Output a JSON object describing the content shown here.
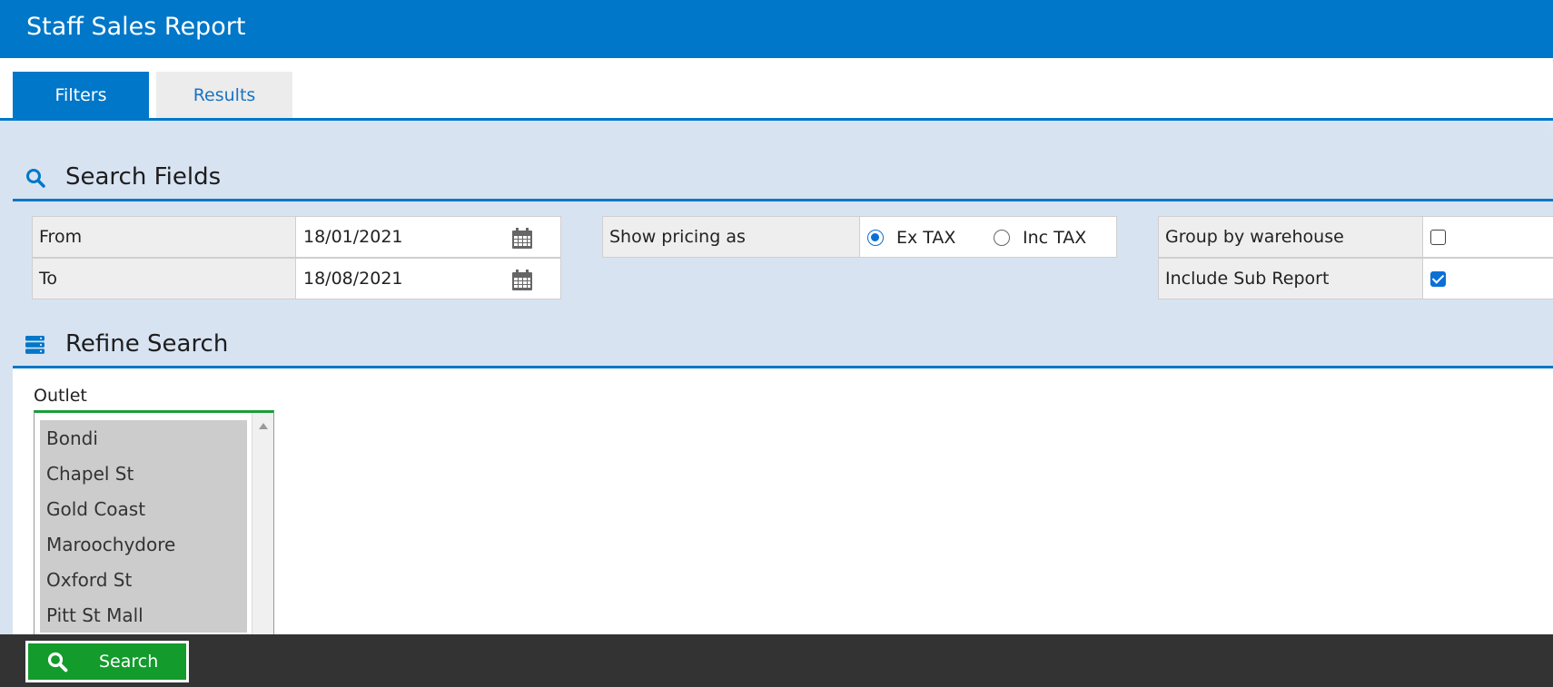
{
  "header": {
    "title": "Staff Sales Report"
  },
  "tabs": [
    {
      "label": "Filters",
      "active": true
    },
    {
      "label": "Results",
      "active": false
    }
  ],
  "search_fields": {
    "title": "Search Fields",
    "from": {
      "label": "From",
      "value": "18/01/2021"
    },
    "to": {
      "label": "To",
      "value": "18/08/2021"
    },
    "pricing": {
      "label": "Show pricing as",
      "options": [
        {
          "label": "Ex TAX",
          "selected": true
        },
        {
          "label": "Inc TAX",
          "selected": false
        }
      ]
    },
    "group_by_warehouse": {
      "label": "Group by warehouse",
      "checked": false
    },
    "include_sub_report": {
      "label": "Include Sub Report",
      "checked": true
    }
  },
  "refine_search": {
    "title": "Refine Search",
    "outlet": {
      "label": "Outlet",
      "items": [
        "Bondi",
        "Chapel St",
        "Gold Coast",
        "Maroochydore",
        "Oxford St",
        "Pitt St Mall"
      ]
    }
  },
  "footer": {
    "search_label": "Search"
  },
  "colors": {
    "primary": "#0077c8",
    "accent_green": "#139b2c",
    "panel_bg": "#d8e3f2",
    "footer_bg": "#333333"
  },
  "icons": {
    "search": "search-icon",
    "calendar": "calendar-icon",
    "refine": "server-stack-icon"
  }
}
